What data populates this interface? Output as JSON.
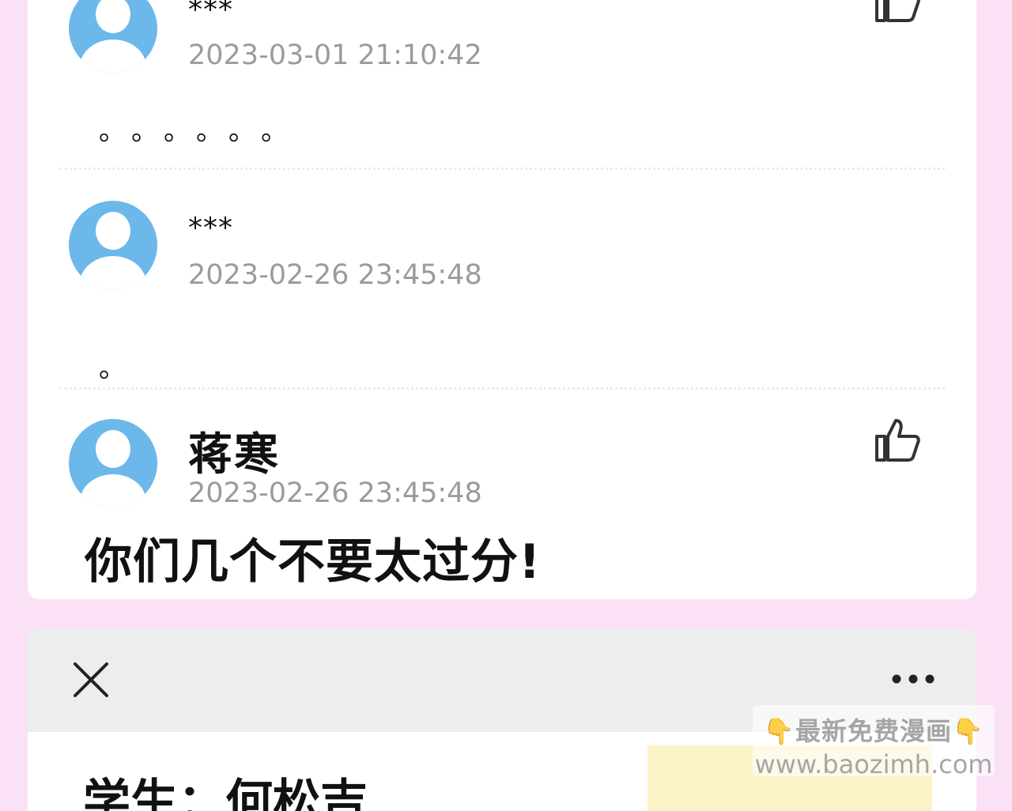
{
  "comments": [
    {
      "username": "***",
      "timestamp": "2023-03-01 21:10:42",
      "content": "。。。。。。",
      "like_icon": "thumbs-up-icon"
    },
    {
      "username": "***",
      "timestamp": "2023-02-26 23:45:48",
      "content": "。"
    },
    {
      "username": "蒋寒",
      "timestamp": "2023-02-26 23:45:48",
      "content": "你们几个不要太过分!",
      "like_icon": "thumbs-up-icon"
    }
  ],
  "next_panel": {
    "close_icon": "close-icon",
    "more_icon": "more-icon",
    "title": "学生：何松吉"
  },
  "watermark": {
    "line1": "👇最新免费漫画👇",
    "line2": "www.baozimh.com"
  },
  "colors": {
    "background": "#fbe1f5",
    "avatar": "#6cb8ea",
    "timestamp": "#9b9b9b"
  }
}
